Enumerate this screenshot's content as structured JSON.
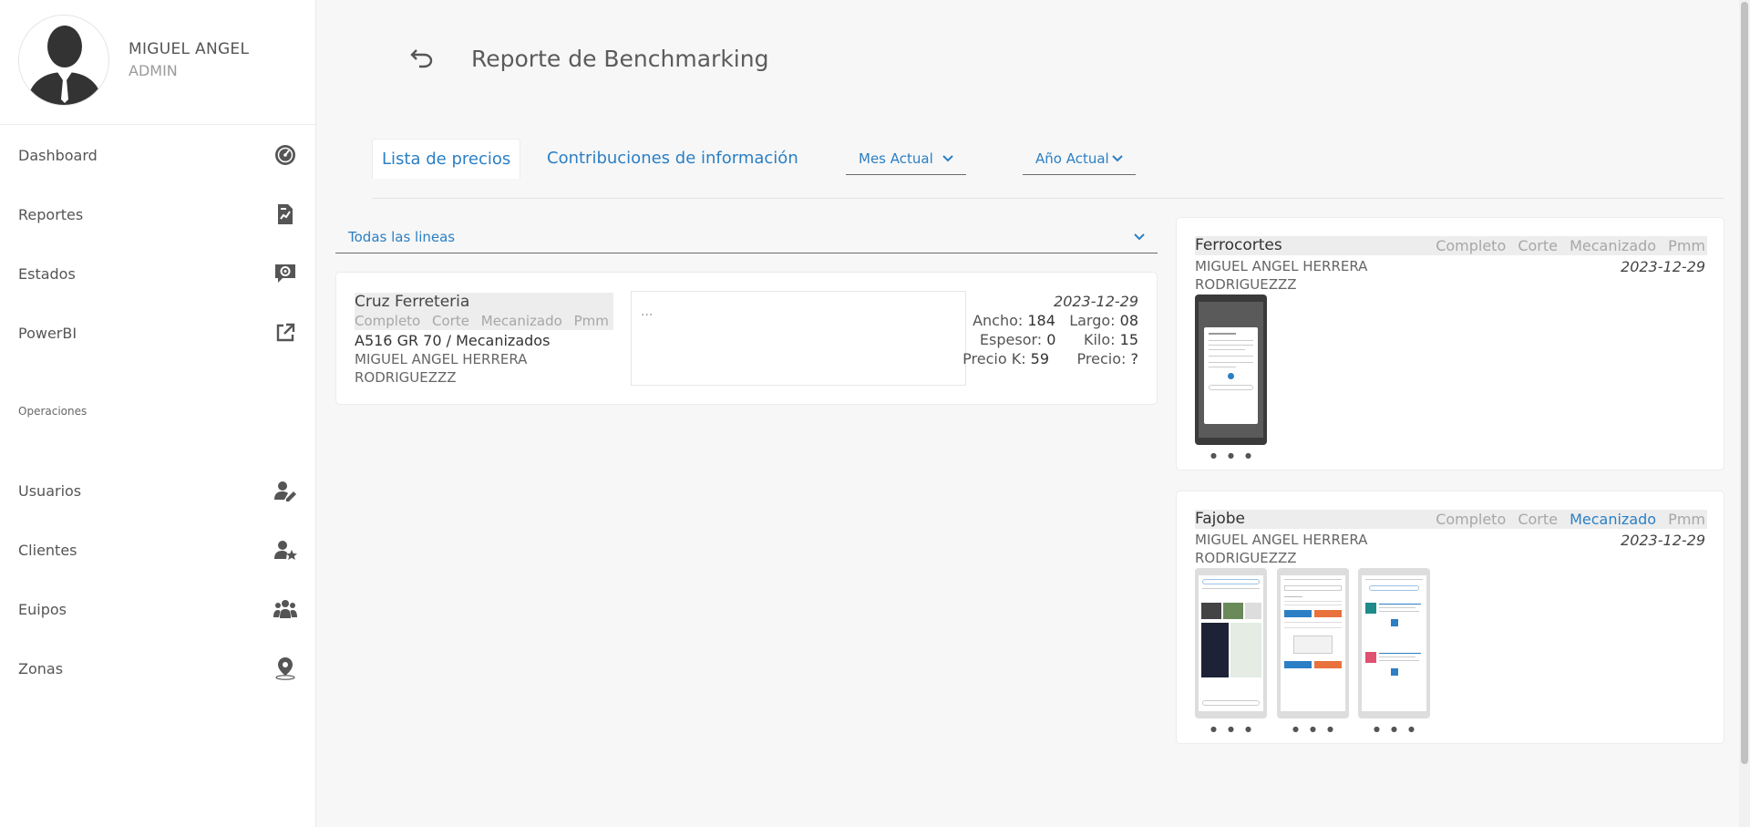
{
  "user": {
    "name": "MIGUEL ANGEL",
    "role": "ADMIN"
  },
  "nav": {
    "items": [
      {
        "label": "Dashboard",
        "icon": "gauge-icon"
      },
      {
        "label": "Reportes",
        "icon": "report-icon"
      },
      {
        "label": "Estados",
        "icon": "chat-gear-icon"
      },
      {
        "label": "PowerBI",
        "icon": "external-link-icon"
      }
    ],
    "section": "Operaciones",
    "ops": [
      {
        "label": "Usuarios",
        "icon": "user-edit-icon"
      },
      {
        "label": "Clientes",
        "icon": "user-star-icon"
      },
      {
        "label": "Euipos",
        "icon": "group-icon"
      },
      {
        "label": "Zonas",
        "icon": "location-pin-icon"
      }
    ]
  },
  "header": {
    "title": "Reporte de Benchmarking"
  },
  "tabs": [
    {
      "label": "Lista de precios"
    },
    {
      "label": "Contribuciones de información"
    }
  ],
  "filters": {
    "month": "Mes Actual",
    "year": "Año Actual",
    "lines": "Todas las lineas"
  },
  "left_card": {
    "name": "Cruz Ferreteria",
    "tags": [
      "Completo",
      "Corte",
      "Mecanizado",
      "Pmm"
    ],
    "product": "A516 GR 70 / Mecanizados",
    "person1": "MIGUEL ANGEL HERRERA",
    "person2": "RODRIGUEZZZ",
    "note": "...",
    "date": "2023-12-29",
    "ancho_label": "Ancho:",
    "ancho": "184",
    "largo_label": "Largo:",
    "largo": "08",
    "espesor_label": "Espesor:",
    "espesor": "0",
    "kilo_label": "Kilo:",
    "kilo": "15",
    "preciok_label": "Precio K:",
    "preciok": "59",
    "precio_label": "Precio:",
    "precio": "?"
  },
  "right_cards": [
    {
      "name": "Ferrocortes",
      "tags": [
        "Completo",
        "Corte",
        "Mecanizado",
        "Pmm"
      ],
      "active_tag": "",
      "person1": "MIGUEL ANGEL HERRERA",
      "person2": "RODRIGUEZZZ",
      "date": "2023-12-29"
    },
    {
      "name": "Fajobe",
      "tags": [
        "Completo",
        "Corte",
        "Mecanizado",
        "Pmm"
      ],
      "active_tag": "Mecanizado",
      "person1": "MIGUEL ANGEL HERRERA",
      "person2": "RODRIGUEZZZ",
      "date": "2023-12-29"
    }
  ],
  "colors": {
    "accent": "#2b7fc4",
    "text": "#555555",
    "highlight": "#ededed"
  }
}
